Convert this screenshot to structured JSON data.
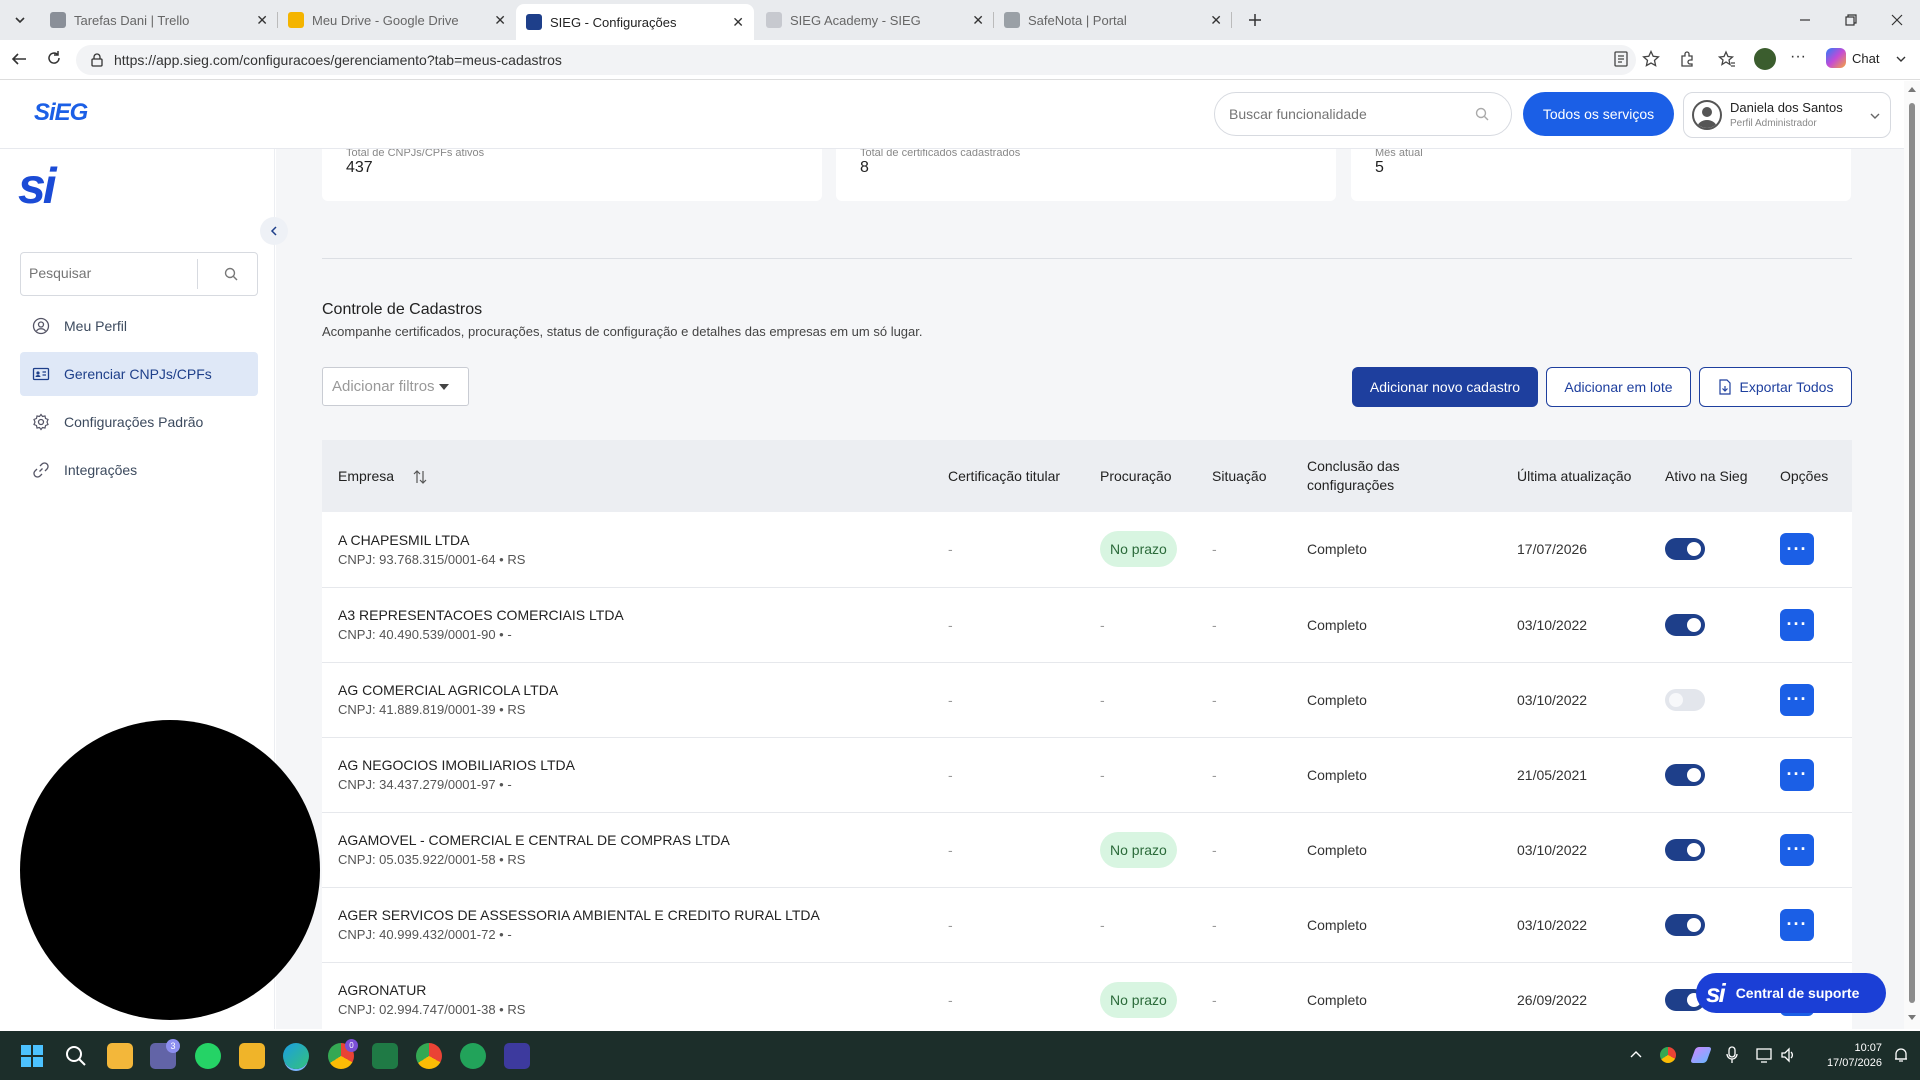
{
  "browser": {
    "tabs": [
      {
        "title": "Tarefas Dani | Trello",
        "color": "#8a8f98"
      },
      {
        "title": "Meu Drive - Google Drive",
        "color": "#f4b400"
      },
      {
        "title": "SIEG - Configurações",
        "color": "#1e3f8a"
      },
      {
        "title": "SIEG Academy - SIEG",
        "color": "#c7c9cf"
      },
      {
        "title": "SafeNota | Portal",
        "color": "#9aa0a6"
      }
    ],
    "url": "https://app.sieg.com/configuracoes/gerenciamento?tab=meus-cadastros",
    "chat_label": "Chat"
  },
  "header": {
    "logo": "SiEG",
    "search_placeholder": "Buscar funcionalidade",
    "all_services": "Todos os serviços",
    "user_name": "Daniela dos Santos",
    "user_role": "Perfil Administrador"
  },
  "sidebar": {
    "logo": "si",
    "search_placeholder": "Pesquisar",
    "items": [
      {
        "label": "Meu Perfil",
        "icon": "user-circle-icon"
      },
      {
        "label": "Gerenciar CNPJs/CPFs",
        "icon": "id-card-icon"
      },
      {
        "label": "Configurações Padrão",
        "icon": "gear-icon"
      },
      {
        "label": "Integrações",
        "icon": "link-icon"
      }
    ]
  },
  "stats": [
    {
      "label": "Total de CNPJs/CPFs ativos",
      "value": "437"
    },
    {
      "label": "Total de certificados cadastrados",
      "value": "8"
    },
    {
      "label": "Mês atual",
      "value": "5"
    }
  ],
  "section": {
    "title": "Controle de Cadastros",
    "subtitle": "Acompanhe certificados, procurações, status de configuração e detalhes das empresas em um só lugar.",
    "filter_placeholder": "Adicionar filtros",
    "add_new": "Adicionar novo cadastro",
    "add_batch": "Adicionar em lote",
    "export_all": "Exportar Todos"
  },
  "table": {
    "headers": {
      "empresa": "Empresa",
      "cert": "Certificação titular",
      "proc": "Procuração",
      "sit": "Situação",
      "concl": "Conclusão das configurações",
      "ultima": "Última atualização",
      "ativo": "Ativo na Sieg",
      "opcoes": "Opções"
    },
    "rows": [
      {
        "name": "A CHAPESMIL LTDA",
        "doc": "CNPJ: 93.768.315/0001-64 • RS",
        "cert": "-",
        "proc": "No prazo",
        "sit": "-",
        "concl": "Completo",
        "date": "17/07/2026",
        "active": true
      },
      {
        "name": "A3 REPRESENTACOES COMERCIAIS LTDA",
        "doc": "CNPJ: 40.490.539/0001-90 • -",
        "cert": "-",
        "proc": "-",
        "sit": "-",
        "concl": "Completo",
        "date": "03/10/2022",
        "active": true
      },
      {
        "name": "AG COMERCIAL AGRICOLA LTDA",
        "doc": "CNPJ: 41.889.819/0001-39 • RS",
        "cert": "-",
        "proc": "-",
        "sit": "-",
        "concl": "Completo",
        "date": "03/10/2022",
        "active": false
      },
      {
        "name": "AG NEGOCIOS IMOBILIARIOS LTDA",
        "doc": "CNPJ: 34.437.279/0001-97 • -",
        "cert": "-",
        "proc": "-",
        "sit": "-",
        "concl": "Completo",
        "date": "21/05/2021",
        "active": true
      },
      {
        "name": "AGAMOVEL - COMERCIAL E CENTRAL DE COMPRAS LTDA",
        "doc": "CNPJ: 05.035.922/0001-58 • RS",
        "cert": "-",
        "proc": "No prazo",
        "sit": "-",
        "concl": "Completo",
        "date": "03/10/2022",
        "active": true
      },
      {
        "name": "AGER SERVICOS DE ASSESSORIA AMBIENTAL E CREDITO RURAL LTDA",
        "doc": "CNPJ: 40.999.432/0001-72 • -",
        "cert": "-",
        "proc": "-",
        "sit": "-",
        "concl": "Completo",
        "date": "03/10/2022",
        "active": true
      },
      {
        "name": "AGRONATUR",
        "doc": "CNPJ: 02.994.747/0001-38 • RS",
        "cert": "-",
        "proc": "No prazo",
        "sit": "-",
        "concl": "Completo",
        "date": "26/09/2022",
        "active": true
      }
    ]
  },
  "support": {
    "logo": "si",
    "label": "Central de suporte"
  },
  "taskbar": {
    "time": "10:07",
    "date": "17/07/2026",
    "teams_badge": "3",
    "chrome_badge": "0"
  }
}
